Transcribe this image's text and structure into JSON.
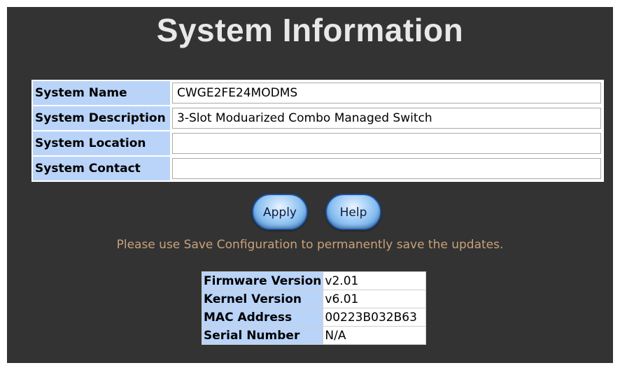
{
  "page": {
    "title": "System Information"
  },
  "form": {
    "rows": [
      {
        "label": "System Name",
        "value": "CWGE2FE24MODMS"
      },
      {
        "label": "System Description",
        "value": "3-Slot Moduarized Combo Managed Switch"
      },
      {
        "label": "System Location",
        "value": ""
      },
      {
        "label": "System Contact",
        "value": ""
      }
    ]
  },
  "buttons": {
    "apply": "Apply",
    "help": "Help"
  },
  "note": "Please use Save Configuration to permanently save the updates.",
  "info": {
    "rows": [
      {
        "label": "Firmware Version",
        "value": "v2.01"
      },
      {
        "label": "Kernel Version",
        "value": "v6.01"
      },
      {
        "label": "MAC Address",
        "value": "00223B032B63"
      },
      {
        "label": "Serial Number",
        "value": "N/A"
      }
    ]
  },
  "colors": {
    "panel_bg": "#333333",
    "label_bg": "#b9d4f8",
    "note_text": "#c8a27a",
    "title_text": "#e8e8e8"
  }
}
